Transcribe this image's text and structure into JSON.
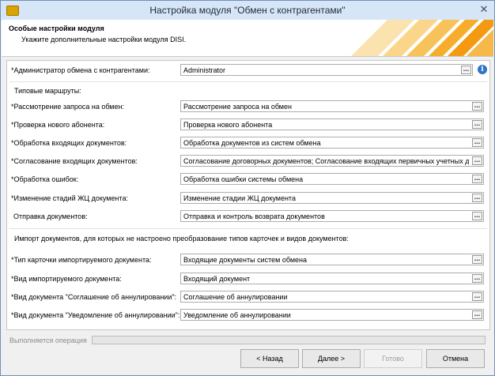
{
  "window": {
    "title": "Настройка модуля \"Обмен с контрагентами\"",
    "close_glyph": "✕"
  },
  "header": {
    "title": "Особые настройки модуля",
    "subtitle": "Укажите дополнительные настройки модуля DISI."
  },
  "admin": {
    "label": "*Администратор обмена с контрагентами:",
    "value": "Administrator",
    "info_glyph": "i"
  },
  "routes_title": "Типовые маршруты:",
  "routes": [
    {
      "label": "*Рассмотрение запроса на обмен:",
      "value": "Рассмотрение запроса на обмен"
    },
    {
      "label": "*Проверка нового абонента:",
      "value": "Проверка нового абонента"
    },
    {
      "label": "*Обработка входящих документов:",
      "value": "Обработка документов из систем обмена"
    },
    {
      "label": "*Согласование входящих документов:",
      "value": "Согласование договорных документов; Согласование входящих первичных учетных документов"
    },
    {
      "label": "*Обработка ошибок:",
      "value": "Обработка ошибки системы обмена"
    },
    {
      "label": "*Изменение стадий ЖЦ документа:",
      "value": "Изменение стадии ЖЦ документа"
    },
    {
      "label": "Отправка документов:",
      "value": "Отправка и контроль возврата документов"
    }
  ],
  "import_title": "Импорт документов, для которых не настроено преобразование типов карточек и видов документов:",
  "imports": [
    {
      "label": "*Тип карточки импортируемого документа:",
      "value": "Входящие документы систем обмена"
    },
    {
      "label": "*Вид импортируемого документа:",
      "value": "Входящий документ"
    },
    {
      "label": "*Вид документа \"Соглашение об аннулировании\":",
      "value": "Соглашение об аннулировании"
    },
    {
      "label": "*Вид документа \"Уведомление об аннулировании\":",
      "value": "Уведомление об аннулировании"
    }
  ],
  "dots_label": "...",
  "status": {
    "text": "Выполняется операция",
    "progress": 0
  },
  "buttons": {
    "back": "< Назад",
    "next": "Далее >",
    "done": "Готово",
    "cancel": "Отмена"
  }
}
